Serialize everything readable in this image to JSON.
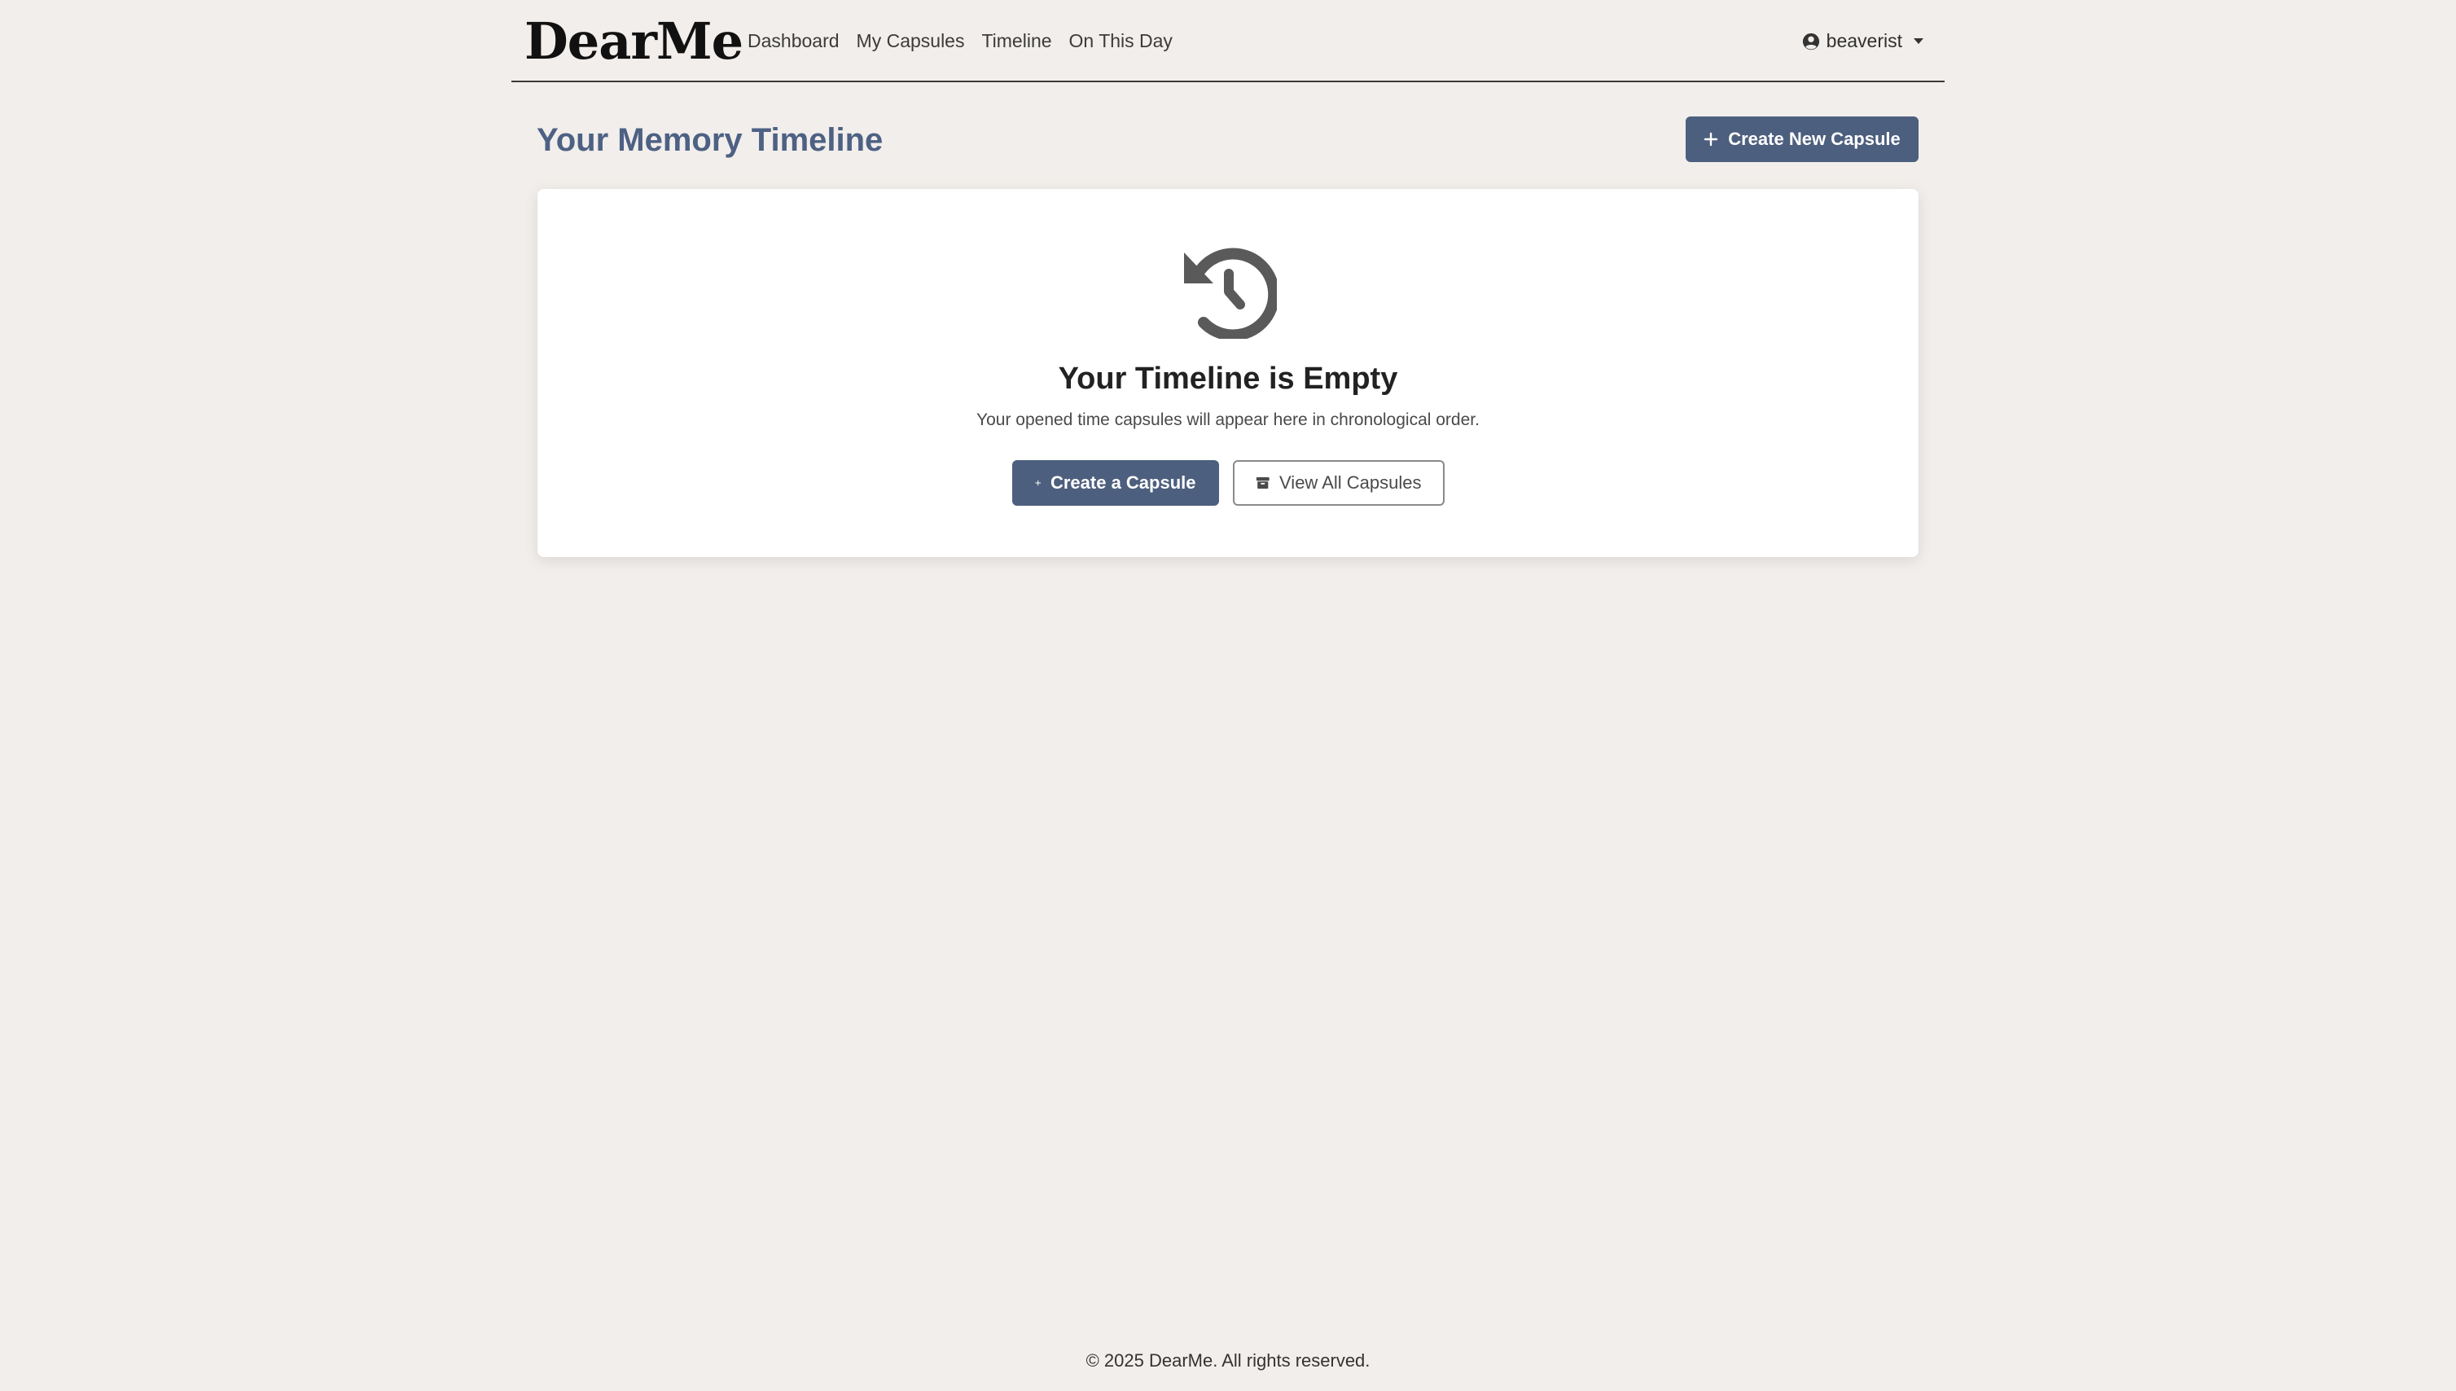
{
  "navbar": {
    "brand": "DearMe",
    "links": [
      {
        "label": "Dashboard"
      },
      {
        "label": "My Capsules"
      },
      {
        "label": "Timeline"
      },
      {
        "label": "On This Day"
      }
    ],
    "user": {
      "icon": "user-circle-icon",
      "username": "beaverist",
      "dropdown_icon": "caret-down-icon"
    }
  },
  "header": {
    "title": "Your Memory Timeline",
    "create_button": {
      "icon": "plus-icon",
      "label": "Create New Capsule"
    }
  },
  "empty_state": {
    "icon": "history-icon",
    "title": "Your Timeline is Empty",
    "description": "Your opened time capsules will appear here in chronological order.",
    "primary_button": {
      "icon": "plus-icon",
      "label": "Create a Capsule"
    },
    "secondary_button": {
      "icon": "archive-box-icon",
      "label": "View All Capsules"
    }
  },
  "footer": {
    "text": "© 2025 DearMe. All rights reserved."
  },
  "colors": {
    "background": "#f2eeeb",
    "accent": "#4d5f7e",
    "title": "#4d6184",
    "card": "#ffffff",
    "icon": "#5a5a5a"
  }
}
